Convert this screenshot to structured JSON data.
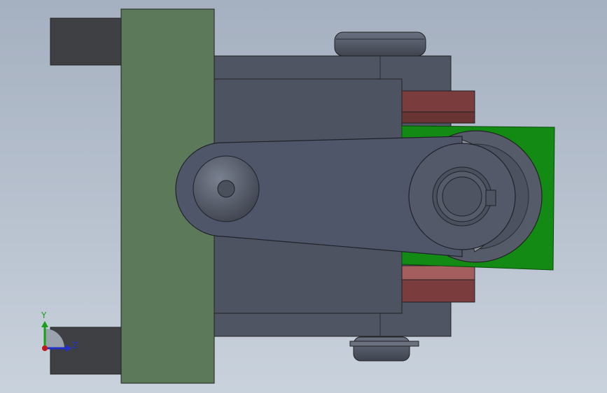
{
  "viewport": {
    "background_top": "#a5b0c0",
    "background_bottom": "#c9d2dc"
  },
  "colors": {
    "plate": "#5c7a5a",
    "body": "#4f5562",
    "body_dark": "#464c58",
    "block": "#3f4043",
    "brick": "#7a3c3c",
    "brick_light": "#a55e5e",
    "green_part": "#138a13",
    "axis_y": "#18a018",
    "axis_z": "#2030c8",
    "origin": "#c01818"
  },
  "triad": {
    "y_label": "Y",
    "z_label": "Z"
  }
}
